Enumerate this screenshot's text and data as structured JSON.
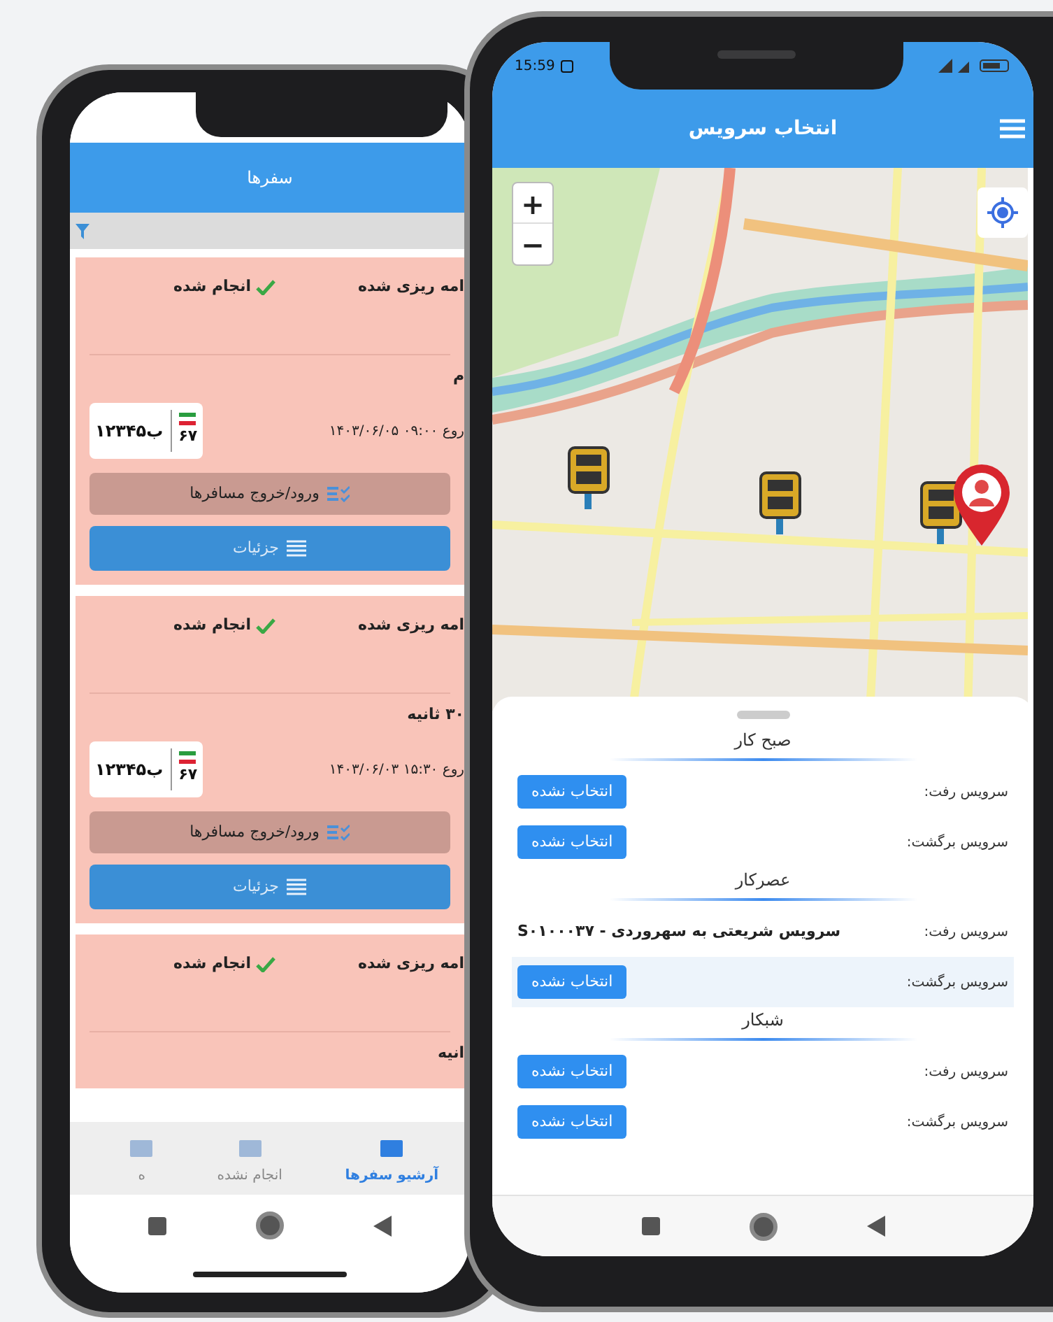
{
  "back_phone": {
    "title": "سفرها",
    "trips": [
      {
        "plan_status": "امه ریزی شده",
        "done_status": "انجام شده",
        "name": "م",
        "datetime": "روع ۰۹:۰۰ ۱۴۰۳/۰۶/۰۵",
        "plate": {
          "number": "۱۲ب۳۴۵",
          "region": "۶۷"
        },
        "passengers_button": "ورود/خروج مسافرها",
        "details_button": "جزئیات"
      },
      {
        "plan_status": "امه ریزی شده",
        "done_status": "انجام شده",
        "name": "۳۰ ثانیه",
        "datetime": "روع ۱۵:۳۰ ۱۴۰۳/۰۶/۰۳",
        "plate": {
          "number": "۱۲ب۳۴۵",
          "region": "۶۷"
        },
        "passengers_button": "ورود/خروج مسافرها",
        "details_button": "جزئیات"
      },
      {
        "plan_status": "امه ریزی شده",
        "done_status": "انجام شده",
        "name": "انیه"
      }
    ],
    "bottom_nav": [
      {
        "label": "آرشیو سفرها",
        "selected": true
      },
      {
        "label": "انجام نشده",
        "selected": false
      },
      {
        "label": "ه",
        "selected": false
      }
    ]
  },
  "front_phone": {
    "status_bar": {
      "time": "15:59"
    },
    "title": "انتخاب سرویس",
    "map": {
      "zoom_in": "+",
      "zoom_out": "−"
    },
    "shifts": [
      {
        "name": "صبح کار",
        "rows": [
          {
            "label": "سرویس رفت:",
            "kind": "button",
            "value": "انتخاب نشده",
            "highlighted": false
          },
          {
            "label": "سرویس برگشت:",
            "kind": "button",
            "value": "انتخاب نشده",
            "highlighted": false
          }
        ]
      },
      {
        "name": "عصرکار",
        "rows": [
          {
            "label": "سرویس رفت:",
            "kind": "text",
            "value": "سرویس شریعتی به سهروردی - S۰۱۰۰۰۳۷",
            "highlighted": false
          },
          {
            "label": "سرویس برگشت:",
            "kind": "button",
            "value": "انتخاب نشده",
            "highlighted": true
          }
        ]
      },
      {
        "name": "شبکار",
        "rows": [
          {
            "label": "سرویس رفت:",
            "kind": "button",
            "value": "انتخاب نشده",
            "highlighted": false
          },
          {
            "label": "سرویس برگشت:",
            "kind": "button",
            "value": "انتخاب نشده",
            "highlighted": false
          }
        ]
      }
    ]
  }
}
